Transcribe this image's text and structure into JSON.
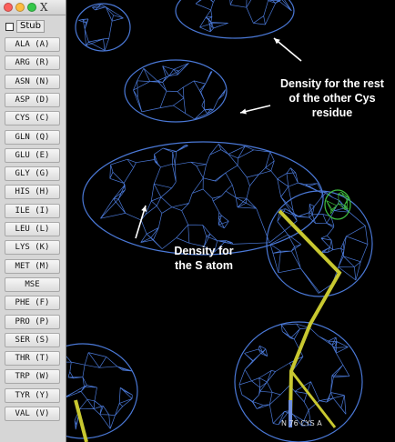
{
  "window": {
    "close_glyph": "X",
    "traffic_lights": [
      "#fc605b",
      "#fdbc40",
      "#34c84a"
    ]
  },
  "palette": {
    "stub_label": "Stub",
    "stub_checked": false,
    "residues": [
      "ALA (A)",
      "ARG (R)",
      "ASN (N)",
      "ASP (D)",
      "CYS (C)",
      "GLN (Q)",
      "GLU (E)",
      "GLY (G)",
      "HIS (H)",
      "ILE (I)",
      "LEU (L)",
      "LYS (K)",
      "MET (M)",
      "MSE",
      "PHE (F)",
      "PRO (P)",
      "SER (S)",
      "THR (T)",
      "TRP (W)",
      "TYR (Y)",
      "VAL (V)"
    ]
  },
  "viewport": {
    "annotation_rest": [
      "Density for the rest",
      "of the other Cys",
      "residue"
    ],
    "annotation_s": [
      "Density for",
      "the S atom"
    ],
    "residue_label": "N 76 CYS A",
    "colors": {
      "background": "#000000",
      "density_mesh": "#4a78d6",
      "model_bonds": "#c8c830",
      "difference_density": "#3fbf3f"
    }
  }
}
